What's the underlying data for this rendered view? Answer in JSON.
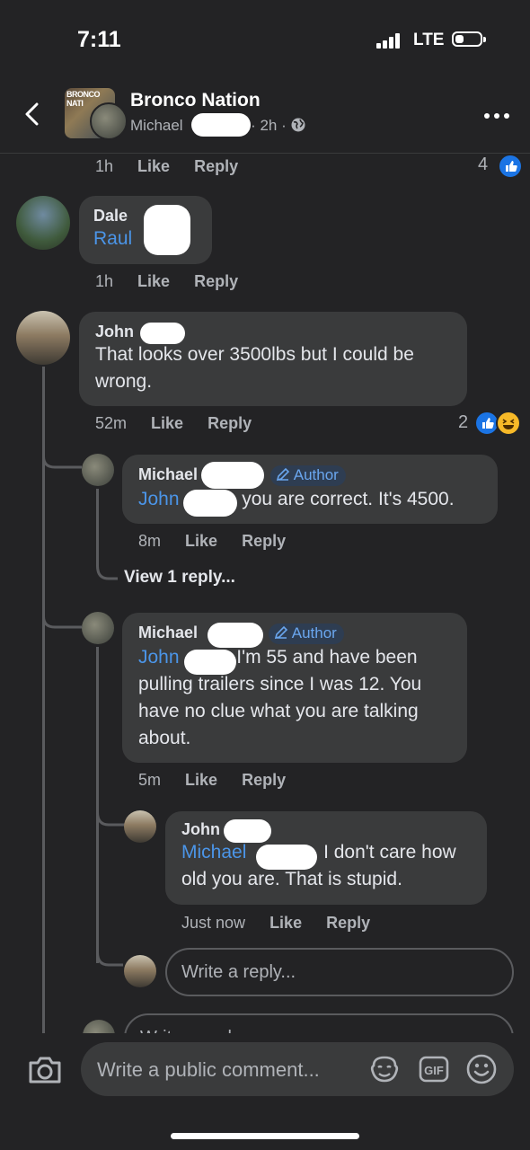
{
  "status": {
    "time": "7:11",
    "network": "LTE"
  },
  "header": {
    "group_name": "Bronco Nation",
    "group_thumb_label": "BRONCO NATI",
    "poster": "Michael",
    "age": "· 2h ·"
  },
  "actions": {
    "like": "Like",
    "reply": "Reply",
    "author": "Author",
    "view_replies": "View 1 reply...",
    "write_reply": "Write a reply...",
    "write_public": "Write a public comment..."
  },
  "top_meta": {
    "time": "1h",
    "reaction_count": "4"
  },
  "comments": [
    {
      "name": "Dale",
      "mention": "Raul",
      "text": "",
      "time": "1h"
    },
    {
      "name": "John",
      "text": "That looks over 3500lbs but I could be wrong.",
      "time": "52m",
      "reaction_count": "2"
    },
    {
      "name": "Michael",
      "mention": "John",
      "text": "you are correct.  It's 4500.",
      "time": "8m"
    },
    {
      "name": "Michael",
      "mention": "John",
      "text": "I'm 55 and have been pulling trailers since I was 12.  You have no clue what you are talking about.",
      "time": "5m"
    },
    {
      "name": "John",
      "mention": "Michael",
      "text": "I don't care how old you are. That is stupid.",
      "time": "Just now"
    }
  ],
  "partial_input_text": "Write a reply"
}
